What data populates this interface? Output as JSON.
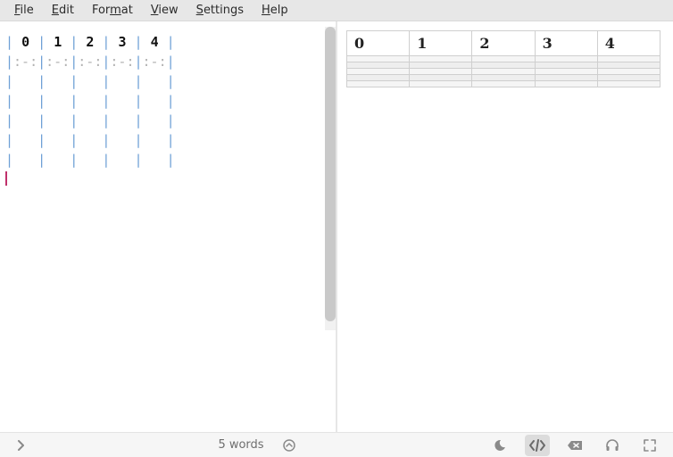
{
  "menu": {
    "file": "File",
    "edit": "Edit",
    "format": "Format",
    "view": "View",
    "settings": "Settings",
    "help": "Help"
  },
  "editor": {
    "header_cells": [
      "0",
      "1",
      "2",
      "3",
      "4"
    ],
    "pipe": "|",
    "sep_cell": ":-:",
    "body_cell": "   ",
    "body_row_count": 5
  },
  "preview": {
    "headers": [
      "0",
      "1",
      "2",
      "3",
      "4"
    ],
    "row_count": 5
  },
  "status": {
    "words": "5 words"
  },
  "chart_data": {
    "type": "table",
    "headers": [
      "0",
      "1",
      "2",
      "3",
      "4"
    ],
    "rows": [
      [
        "",
        "",
        "",
        "",
        ""
      ],
      [
        "",
        "",
        "",
        "",
        ""
      ],
      [
        "",
        "",
        "",
        "",
        ""
      ],
      [
        "",
        "",
        "",
        "",
        ""
      ],
      [
        "",
        "",
        "",
        "",
        ""
      ]
    ]
  }
}
